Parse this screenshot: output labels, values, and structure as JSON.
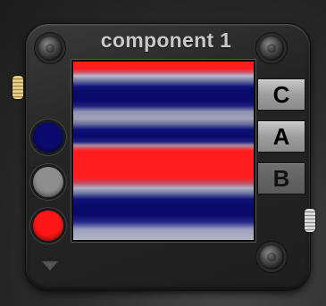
{
  "title": "component 1",
  "display": {
    "stripe_colors": [
      "#ff1d1d",
      "#0a0a6a",
      "#a2a1b6",
      "#ff1d1d",
      "#0a0a6a"
    ]
  },
  "swatches": [
    {
      "name": "navy",
      "color": "#0b0b6e"
    },
    {
      "name": "gray",
      "color": "#8e8e8e"
    },
    {
      "name": "red",
      "color": "#ff1616"
    }
  ],
  "tabs": [
    {
      "label": "C",
      "state": "active"
    },
    {
      "label": "A",
      "state": "active"
    },
    {
      "label": "B",
      "state": "inactive"
    }
  ]
}
